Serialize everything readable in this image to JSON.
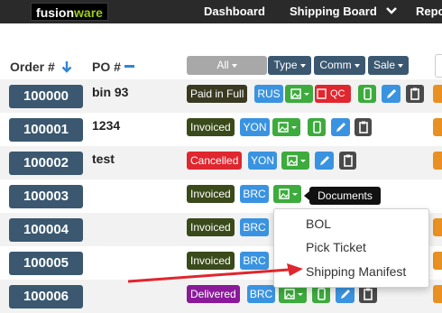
{
  "app": {
    "logo_left": "fusion",
    "logo_right": "ware"
  },
  "nav": {
    "items": [
      "Dashboard",
      "Shipping Board",
      "Repo"
    ]
  },
  "table": {
    "headers": {
      "order": "Order #",
      "po": "PO #"
    },
    "filters": [
      "All",
      "Type",
      "Comm",
      "Sale"
    ],
    "rows": [
      {
        "order": "100000",
        "po": "bin 93",
        "status": "Paid in Full",
        "tag": "RUS",
        "qc": "QC"
      },
      {
        "order": "100001",
        "po": "1234",
        "status": "Invoiced",
        "tag": "YON"
      },
      {
        "order": "100002",
        "po": "test",
        "status": "Cancelled",
        "tag": "YON"
      },
      {
        "order": "100003",
        "po": "",
        "status": "Invoiced",
        "tag": "BRC"
      },
      {
        "order": "100004",
        "po": "",
        "status": "Invoiced",
        "tag": "BRC"
      },
      {
        "order": "100005",
        "po": "",
        "status": "Invoiced",
        "tag": "BRC"
      },
      {
        "order": "100006",
        "po": "",
        "status": "Delivered",
        "tag": "BRC"
      }
    ]
  },
  "tooltip": {
    "text": "Documents"
  },
  "documents_menu": {
    "items": [
      "BOL",
      "Pick Ticket",
      "Shipping Manifest"
    ]
  },
  "colors": {
    "order_badge": "#3b5870",
    "paid_in_full": "#3a3a22",
    "invoiced": "#3a4a1a",
    "cancelled": "#e0262e",
    "delivered": "#8a1a9a",
    "tag_blue": "#3a93e0",
    "action_green": "#3dab3d",
    "annotation_red": "#e0262e"
  }
}
